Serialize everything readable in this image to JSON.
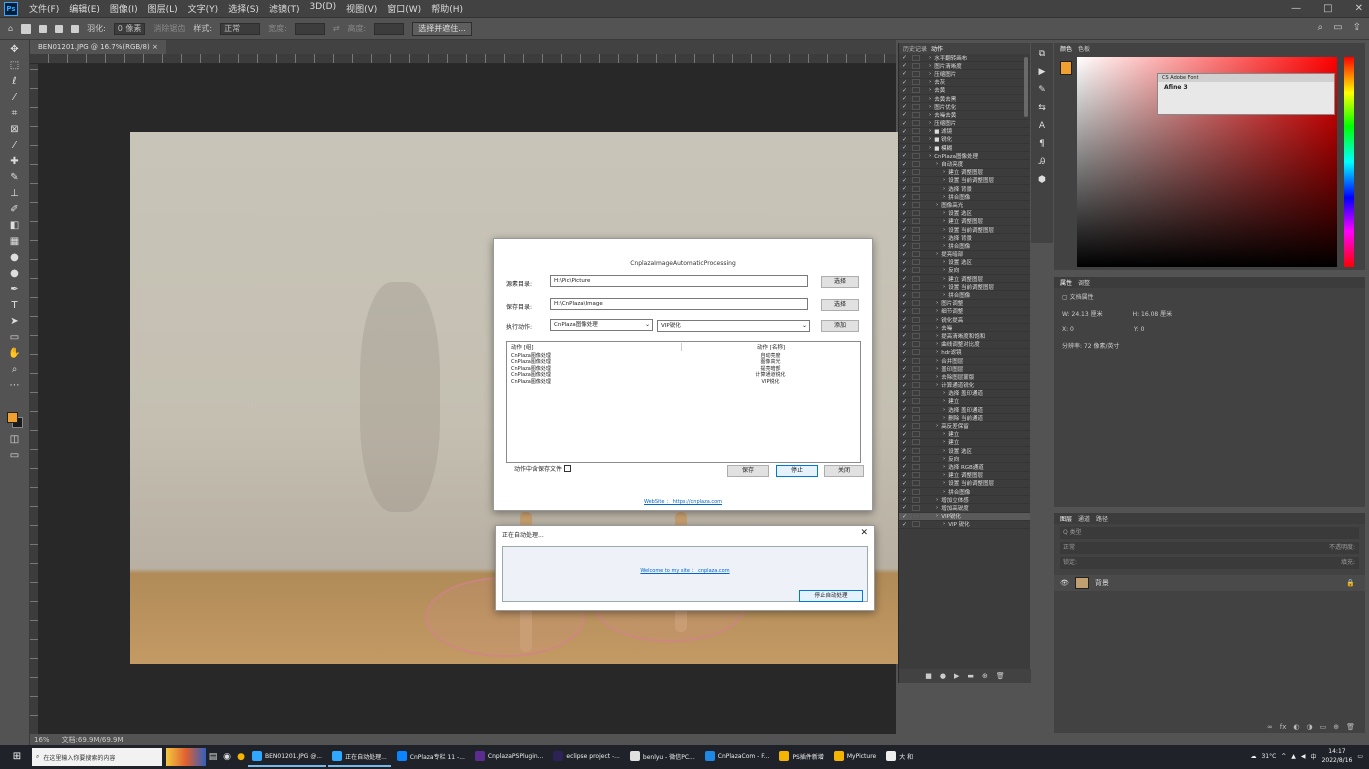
{
  "menu": {
    "items": [
      "文件(F)",
      "编辑(E)",
      "图像(I)",
      "图层(L)",
      "文字(Y)",
      "选择(S)",
      "滤镜(T)",
      "3D(D)",
      "视图(V)",
      "窗口(W)",
      "帮助(H)"
    ],
    "window_controls": [
      "—",
      "□",
      "✕"
    ]
  },
  "options": {
    "feather_label": "羽化:",
    "feather_value": "0 像素",
    "aa_label": "消除锯齿",
    "style_label": "样式:",
    "style_value": "正常",
    "width_label": "宽度:",
    "height_label": "高度:",
    "mask_button": "选择并遮住..."
  },
  "document": {
    "tab_title": "BEN01201.JPG @ 16.7%(RGB/8) ×",
    "zoom": "16%",
    "doc_info": "文档:69.9M/69.9M"
  },
  "actions_panel": {
    "tabs": [
      "历史记录",
      "动作"
    ],
    "active_tab": "动作",
    "rows": [
      {
        "indent": 1,
        "text": "水平翻转画布"
      },
      {
        "indent": 1,
        "text": "图片清晰度"
      },
      {
        "indent": 1,
        "text": "压缩图片"
      },
      {
        "indent": 1,
        "text": "去灰"
      },
      {
        "indent": 1,
        "text": "去黄"
      },
      {
        "indent": 1,
        "text": "去黄去黑"
      },
      {
        "indent": 1,
        "text": "图片优化"
      },
      {
        "indent": 1,
        "text": "去噪去黄"
      },
      {
        "indent": 1,
        "text": "压缩图片"
      },
      {
        "indent": 1,
        "text": "■ 滤镜"
      },
      {
        "indent": 1,
        "text": "■ 锐化"
      },
      {
        "indent": 1,
        "text": "■ 模糊"
      },
      {
        "indent": 1,
        "text": "CnPlaza图像处理"
      },
      {
        "indent": 2,
        "text": "自动亮度"
      },
      {
        "indent": 3,
        "text": "建立 调整图层"
      },
      {
        "indent": 3,
        "text": "设置 当前调整图层"
      },
      {
        "indent": 3,
        "text": "选择 背景"
      },
      {
        "indent": 3,
        "text": "拼合图像"
      },
      {
        "indent": 2,
        "text": "图像高光"
      },
      {
        "indent": 3,
        "text": "设置 选区"
      },
      {
        "indent": 3,
        "text": "建立 调整图层"
      },
      {
        "indent": 3,
        "text": "设置 当前调整图层"
      },
      {
        "indent": 3,
        "text": "选择 背景"
      },
      {
        "indent": 3,
        "text": "拼合图像"
      },
      {
        "indent": 2,
        "text": "提亮暗部"
      },
      {
        "indent": 3,
        "text": "设置 选区"
      },
      {
        "indent": 3,
        "text": "反向"
      },
      {
        "indent": 3,
        "text": "建立 调整图层"
      },
      {
        "indent": 3,
        "text": "设置 当前调整图层"
      },
      {
        "indent": 3,
        "text": "拼合图像"
      },
      {
        "indent": 2,
        "text": "图片调整"
      },
      {
        "indent": 2,
        "text": "细节调整"
      },
      {
        "indent": 2,
        "text": "锐化提高"
      },
      {
        "indent": 2,
        "text": "去噪"
      },
      {
        "indent": 2,
        "text": "提高清晰度和饱和"
      },
      {
        "indent": 2,
        "text": "曲线调整对比度"
      },
      {
        "indent": 2,
        "text": "hdr滤镜"
      },
      {
        "indent": 2,
        "text": "合并图层"
      },
      {
        "indent": 2,
        "text": "盖印图层"
      },
      {
        "indent": 2,
        "text": "去除图层蒙版"
      },
      {
        "indent": 2,
        "text": "计算通道锐化"
      },
      {
        "indent": 3,
        "text": "选择 盖印通道"
      },
      {
        "indent": 3,
        "text": "建立"
      },
      {
        "indent": 3,
        "text": "选择 盖印通道"
      },
      {
        "indent": 3,
        "text": "删除 当前通道"
      },
      {
        "indent": 2,
        "text": "高反差保留"
      },
      {
        "indent": 3,
        "text": "建立"
      },
      {
        "indent": 3,
        "text": "建立"
      },
      {
        "indent": 3,
        "text": "设置 选区"
      },
      {
        "indent": 3,
        "text": "反向"
      },
      {
        "indent": 3,
        "text": "选择 RGB通道"
      },
      {
        "indent": 3,
        "text": "建立 调整图层"
      },
      {
        "indent": 3,
        "text": "设置 当前调整图层"
      },
      {
        "indent": 3,
        "text": "拼合图像"
      },
      {
        "indent": 2,
        "text": "增加立体感"
      },
      {
        "indent": 2,
        "text": "增加高锐度"
      },
      {
        "indent": 2,
        "text": "VIP锐化"
      },
      {
        "indent": 3,
        "text": "VIP 锐化"
      }
    ],
    "selected_index": 56
  },
  "color_panel": {
    "tabs": [
      "颜色",
      "色板"
    ],
    "fg_color": "#f0a030",
    "float_title": "CS Adobe Font",
    "float_text": "Afine 3"
  },
  "properties_panel": {
    "tabs": [
      "属性",
      "调整"
    ],
    "type_label": "文档属性",
    "w_label": "W: 24.13 厘米",
    "h_label": "H: 16.08 厘米",
    "x_label": "X: 0",
    "y_label": "Y: 0",
    "res_label": "分辨率: 72 像素/英寸"
  },
  "layers_panel": {
    "tabs": [
      "图层",
      "通道",
      "路径"
    ],
    "kind_label": "Q 类型",
    "blend_mode": "正常",
    "opacity_label": "不透明度:",
    "lock_label": "锁定:",
    "fill_label": "填充:",
    "layer_name": "背景",
    "footer_icons": [
      "∞",
      "fx",
      "◐",
      "◑",
      "▭",
      "⊕",
      "🗑"
    ]
  },
  "main_dialog": {
    "title": "CnplazaImageAutomaticProcessing",
    "source_label": "源素目录:",
    "source_value": "H:\\Pic\\Picture",
    "source_btn": "选择",
    "save_label": "保存目录:",
    "save_value": "H:\\CnPlaza\\Image",
    "save_btn": "选择",
    "exec_label": "执行动作:",
    "action_set": "CnPlaza图像处理",
    "action_name": "VIP锐化",
    "add_btn": "添加",
    "col1": "动作 [组]",
    "col2": "动作 [名称]",
    "list": [
      {
        "group": "CnPlaza图像处理",
        "name": "自动亮度"
      },
      {
        "group": "CnPlaza图像处理",
        "name": "图像高光"
      },
      {
        "group": "CnPlaza图像处理",
        "name": "提亮暗部"
      },
      {
        "group": "CnPlaza图像处理",
        "name": "计算通道锐化"
      },
      {
        "group": "CnPlaza图像处理",
        "name": "VIP锐化"
      }
    ],
    "checkbox_label": "动作中含保存文件",
    "save_action_btn": "保存",
    "stop_btn": "停止",
    "close_btn": "关闭",
    "website": "WebSite ： https://cnplaza.com"
  },
  "progress_dialog": {
    "title": "正在自动处理...",
    "welcome": "Welcome to my site ： cnplaza.com",
    "stop_button": "停止自动处理"
  },
  "taskbar": {
    "search_placeholder": "在这里输入你要搜索的内容",
    "apps": [
      {
        "label": "BEN01201.JPG @...",
        "color": "#31a8ff",
        "open": true
      },
      {
        "label": "正在自动处理...",
        "color": "#31a8ff",
        "open": true
      },
      {
        "label": "CnPlaza专栏 11 -...",
        "color": "#0a84ff",
        "open": false
      },
      {
        "label": "CnplazaPSPlugin...",
        "color": "#5c2d91",
        "open": false
      },
      {
        "label": "eclipse project -...",
        "color": "#2c2255",
        "open": false
      },
      {
        "label": "benlyu - 微信PC...",
        "color": "#e0e0e0",
        "open": false
      },
      {
        "label": "CnPlazaCom - F...",
        "color": "#1e88e5",
        "open": false
      },
      {
        "label": "PS插件新增",
        "color": "#f4b400",
        "open": false
      },
      {
        "label": "MyPicture",
        "color": "#f4b400",
        "open": false
      },
      {
        "label": "大 和",
        "color": "#eee",
        "open": false
      }
    ],
    "weather": "31°C",
    "time": "14:17",
    "date": "2022/8/16"
  }
}
